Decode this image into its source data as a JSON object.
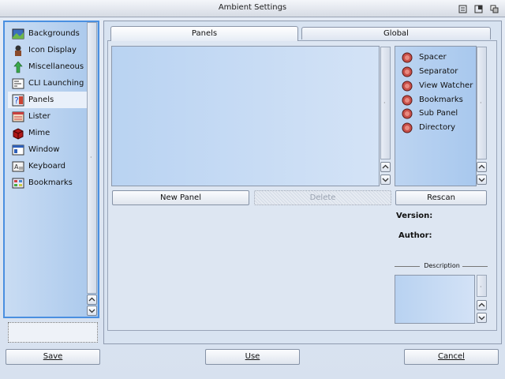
{
  "window": {
    "title": "Ambient Settings"
  },
  "categories": [
    {
      "label": "Backgrounds",
      "icon": "backgrounds-icon"
    },
    {
      "label": "Icon Display",
      "icon": "icon-display-icon"
    },
    {
      "label": "Miscellaneous",
      "icon": "miscellaneous-icon"
    },
    {
      "label": "CLI Launching",
      "icon": "cli-launching-icon"
    },
    {
      "label": "Panels",
      "icon": "panels-icon",
      "selected": true
    },
    {
      "label": "Lister",
      "icon": "lister-icon"
    },
    {
      "label": "Mime",
      "icon": "mime-icon"
    },
    {
      "label": "Window",
      "icon": "window-icon"
    },
    {
      "label": "Keyboard",
      "icon": "keyboard-icon"
    },
    {
      "label": "Bookmarks",
      "icon": "bookmarks-icon"
    }
  ],
  "tabs": {
    "panels": "Panels",
    "global": "Global"
  },
  "plugins": [
    "Spacer",
    "Separator",
    "View Watcher",
    "Bookmarks",
    "Sub Panel",
    "Directory"
  ],
  "buttons": {
    "new_panel": "New Panel",
    "delete": "Delete",
    "rescan": "Rescan",
    "save": "Save",
    "use": "Use",
    "cancel": "Cancel"
  },
  "info": {
    "version_label": "Version:",
    "author_label": "Author:",
    "description_label": "Description"
  },
  "colors": {
    "accent": "#4a8fe0",
    "list_bg": "#b9d3f2",
    "bulb": "#c8504a"
  }
}
